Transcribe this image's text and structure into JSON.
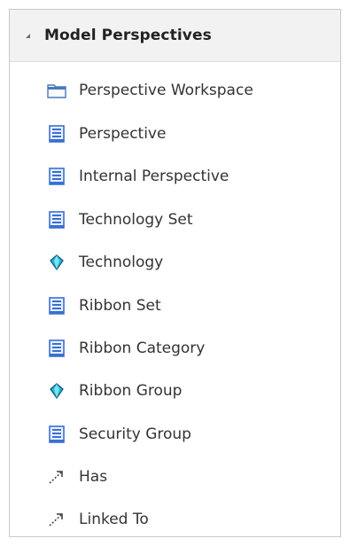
{
  "panel": {
    "title": "Model Perspectives",
    "items": [
      {
        "label": "Perspective Workspace",
        "icon": "folder-icon"
      },
      {
        "label": "Perspective",
        "icon": "document-icon"
      },
      {
        "label": "Internal Perspective",
        "icon": "document-icon"
      },
      {
        "label": "Technology Set",
        "icon": "document-icon"
      },
      {
        "label": "Technology",
        "icon": "gem-icon"
      },
      {
        "label": "Ribbon Set",
        "icon": "document-icon"
      },
      {
        "label": "Ribbon Category",
        "icon": "document-icon"
      },
      {
        "label": "Ribbon Group",
        "icon": "gem-icon"
      },
      {
        "label": "Security Group",
        "icon": "document-icon"
      },
      {
        "label": "Has",
        "icon": "connector-icon"
      },
      {
        "label": "Linked To",
        "icon": "connector-icon"
      }
    ]
  },
  "colors": {
    "header_bg": "#f2f2f2",
    "doc_blue": "#3a6fd1",
    "gem_teal": "#22b8cf",
    "folder_blue": "#4a78b8"
  }
}
